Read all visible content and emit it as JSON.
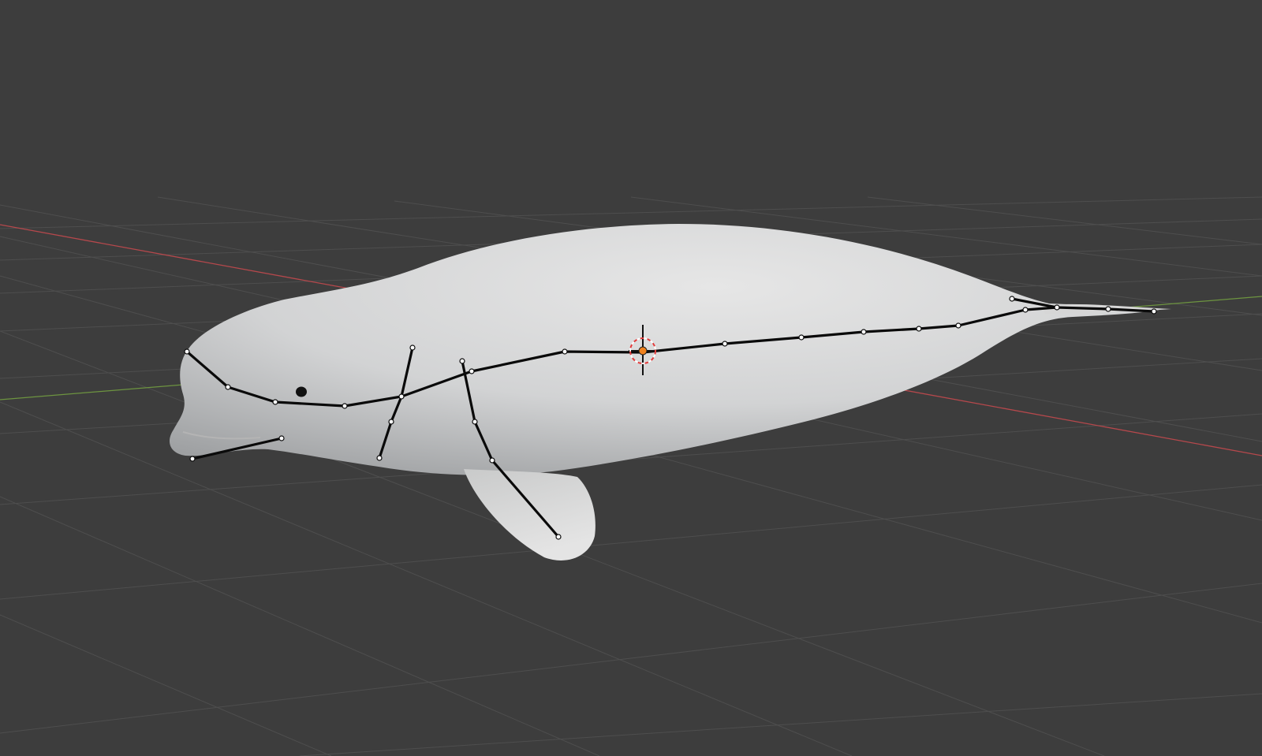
{
  "viewport": {
    "background": "#3d3d3d",
    "grid_color": "#4e4e4e",
    "x_axis_color": "#b5484c",
    "y_axis_color": "#6d9440",
    "mesh_color": "#dcdcdc"
  },
  "scene": {
    "object": "beluga-whale-mesh",
    "armature_bone_color": "#0a0a0a",
    "origin_color": "#f0821e",
    "cursor_ring_color": "#e33b3b"
  }
}
